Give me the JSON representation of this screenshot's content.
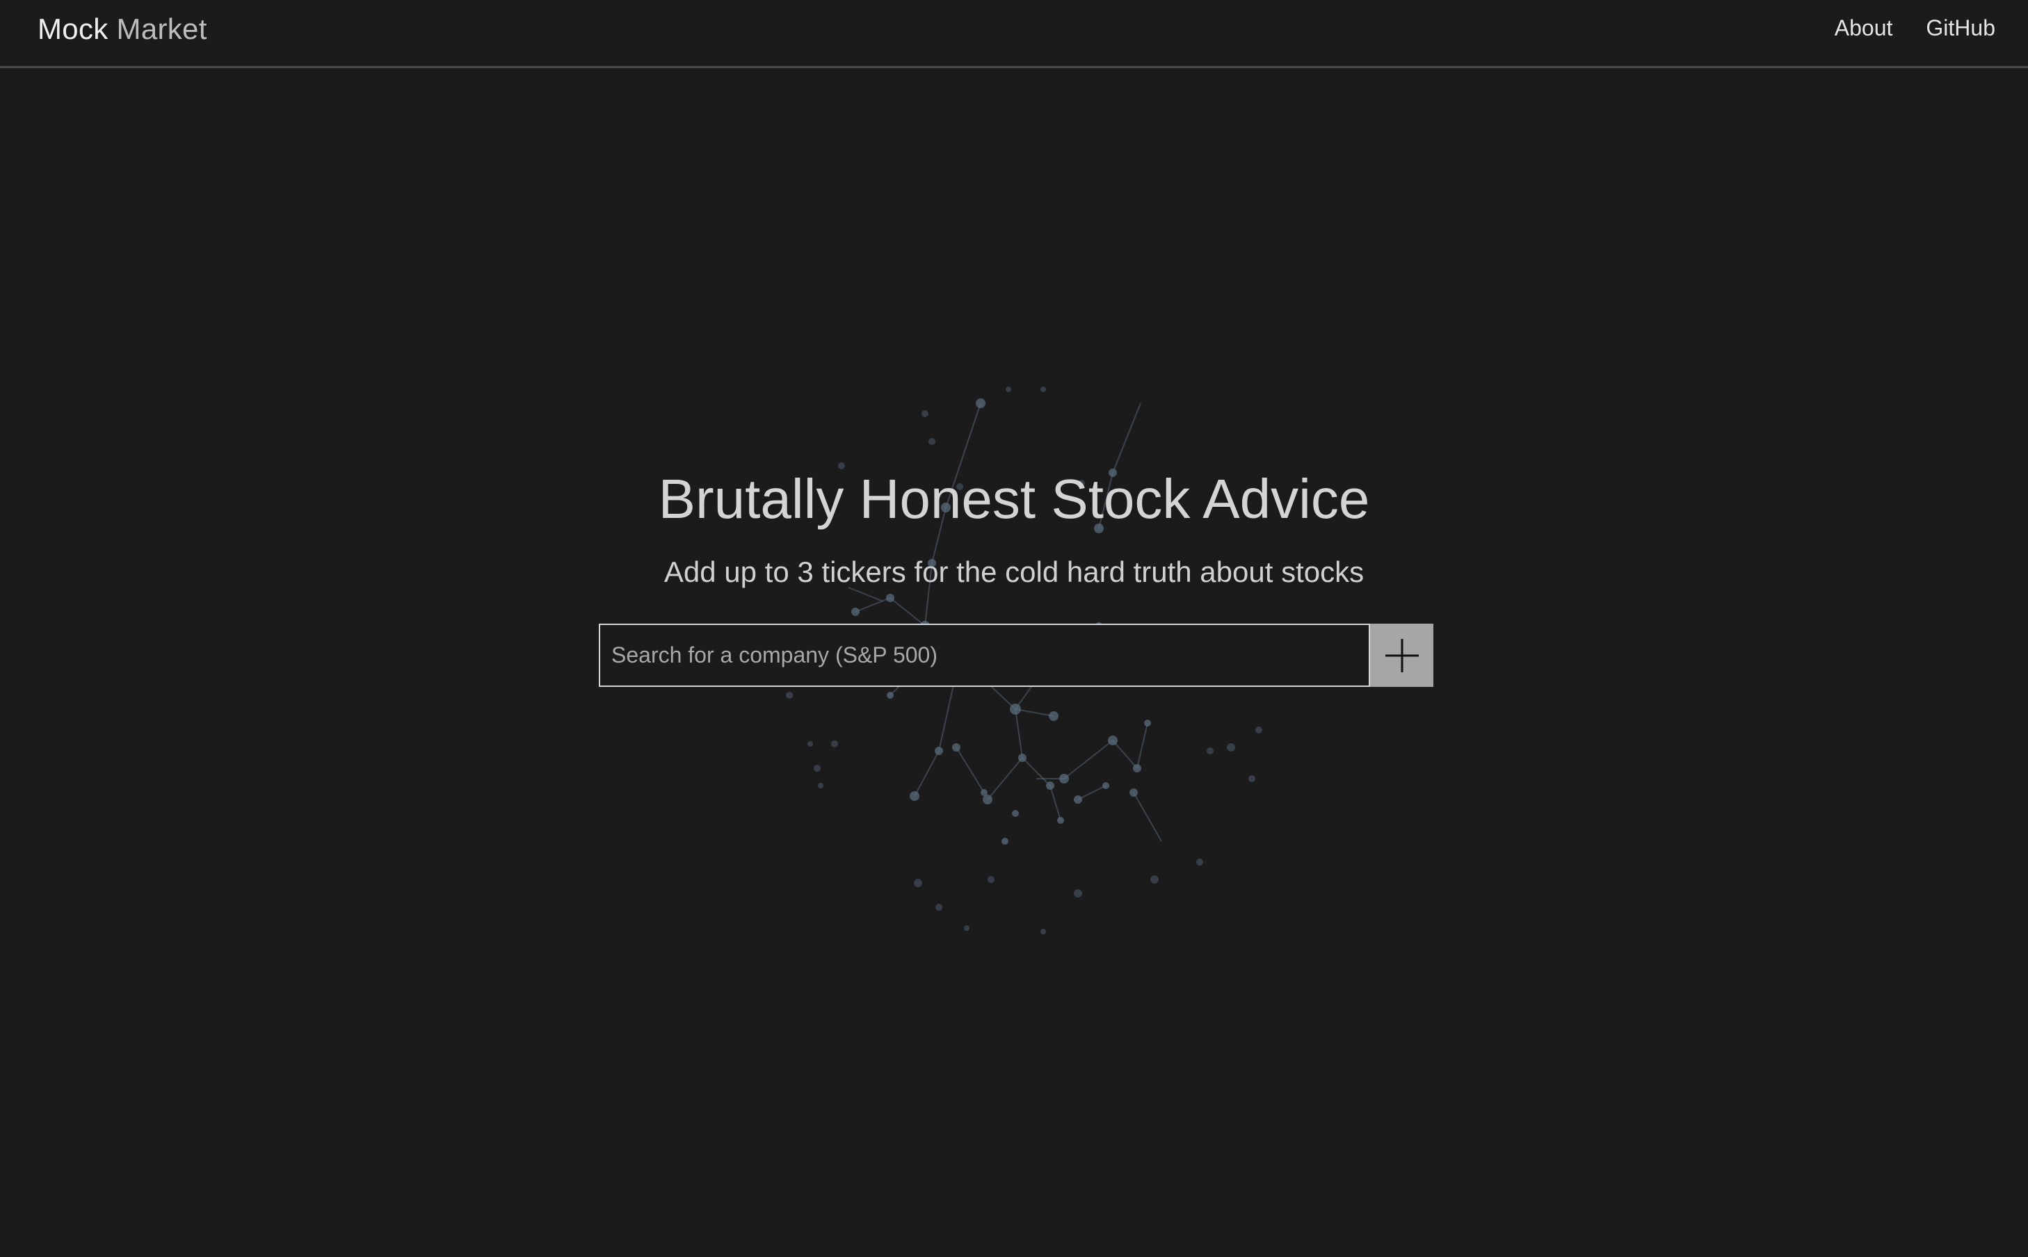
{
  "nav": {
    "brand_primary": "Mock",
    "brand_secondary": "Market",
    "links": [
      {
        "label": "About"
      },
      {
        "label": "GitHub"
      }
    ]
  },
  "hero": {
    "title": "Brutally Honest Stock Advice",
    "subtitle": "Add up to 3 tickers for the cold hard truth about stocks"
  },
  "search": {
    "value": "",
    "placeholder": "Search for a company (S&P 500)",
    "add_icon": "plus-icon"
  },
  "colors": {
    "background": "#1b1b1b",
    "text": "#d4d4d4",
    "button": "#a6a6a6",
    "network_node": "#5a6c7c"
  }
}
